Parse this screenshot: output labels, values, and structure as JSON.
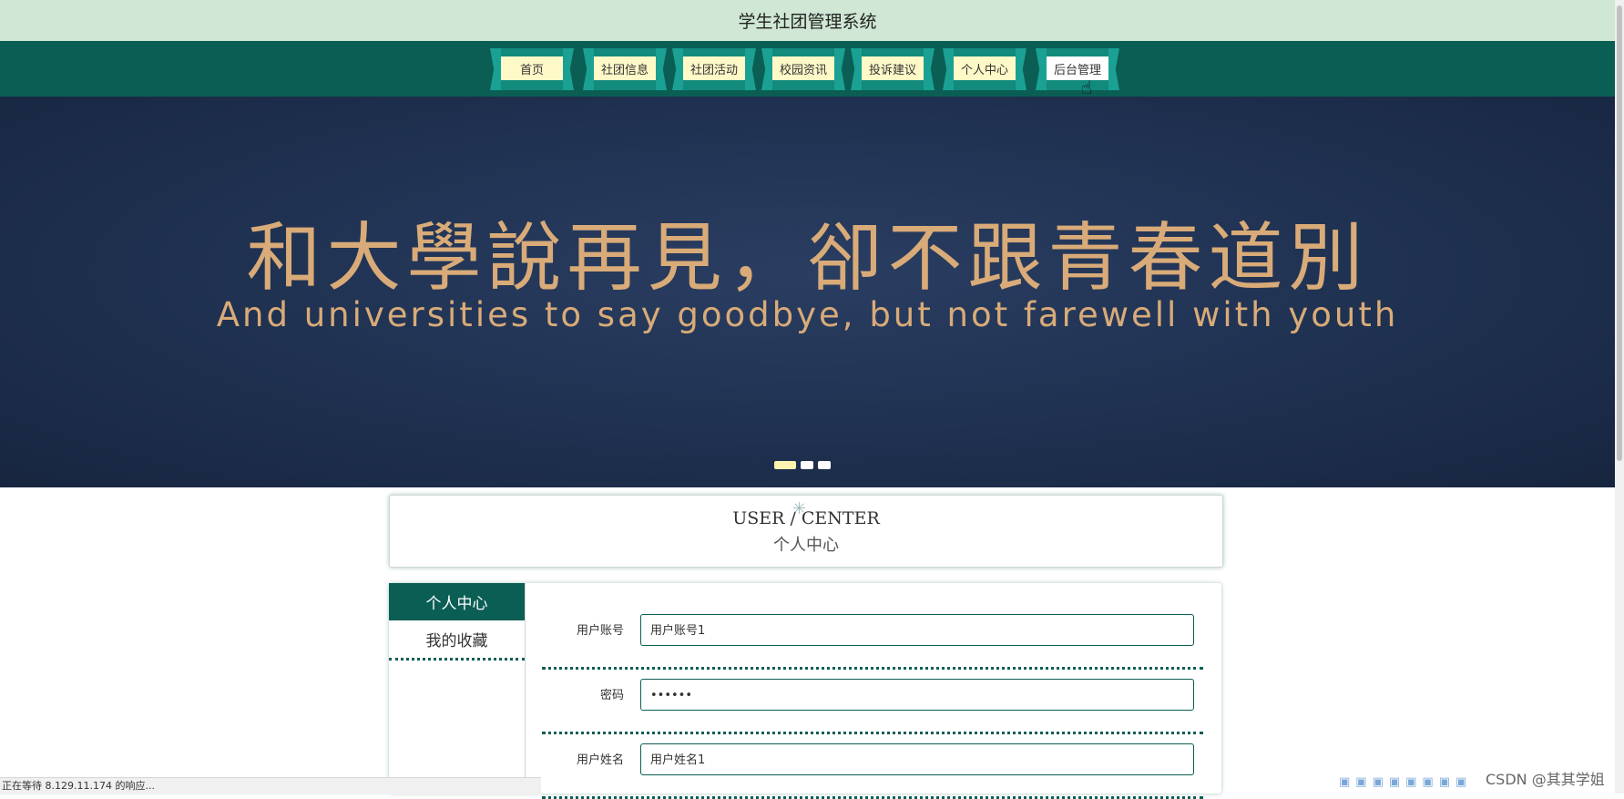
{
  "site_title": "学生社团管理系统",
  "nav": {
    "items": [
      {
        "label": "首页"
      },
      {
        "label": "社团信息"
      },
      {
        "label": "社团活动"
      },
      {
        "label": "校园资讯"
      },
      {
        "label": "投诉建议"
      },
      {
        "label": "个人中心"
      },
      {
        "label": "后台管理"
      }
    ],
    "active": "后台管理"
  },
  "banner": {
    "headline": "和大學說再見，卻不跟青春道別",
    "subline": "And universities to say goodbye, but not farewell with youth",
    "slides": 3,
    "active_slide": 1
  },
  "section": {
    "title_en": "USER / CENTER",
    "title_cn": "个人中心"
  },
  "sidebar": {
    "items": [
      {
        "label": "个人中心"
      },
      {
        "label": "我的收藏"
      }
    ],
    "active": "个人中心"
  },
  "form": {
    "fields": [
      {
        "label": "用户账号",
        "value": "用户账号1"
      },
      {
        "label": "密码",
        "value": "••••••"
      },
      {
        "label": "用户姓名",
        "value": "用户姓名1"
      }
    ]
  },
  "status_bar": "正在等待 8.129.11.174 的响应...",
  "watermark": "CSDN @其其学姐",
  "colors": {
    "header_bg": "#cfe7d4",
    "nav_bg": "#0b5e54",
    "ribbon": "#1aa194",
    "nav_label_bg": "#fff9c8",
    "banner_bg": "#1f3150",
    "banner_text": "#d9ab78"
  }
}
